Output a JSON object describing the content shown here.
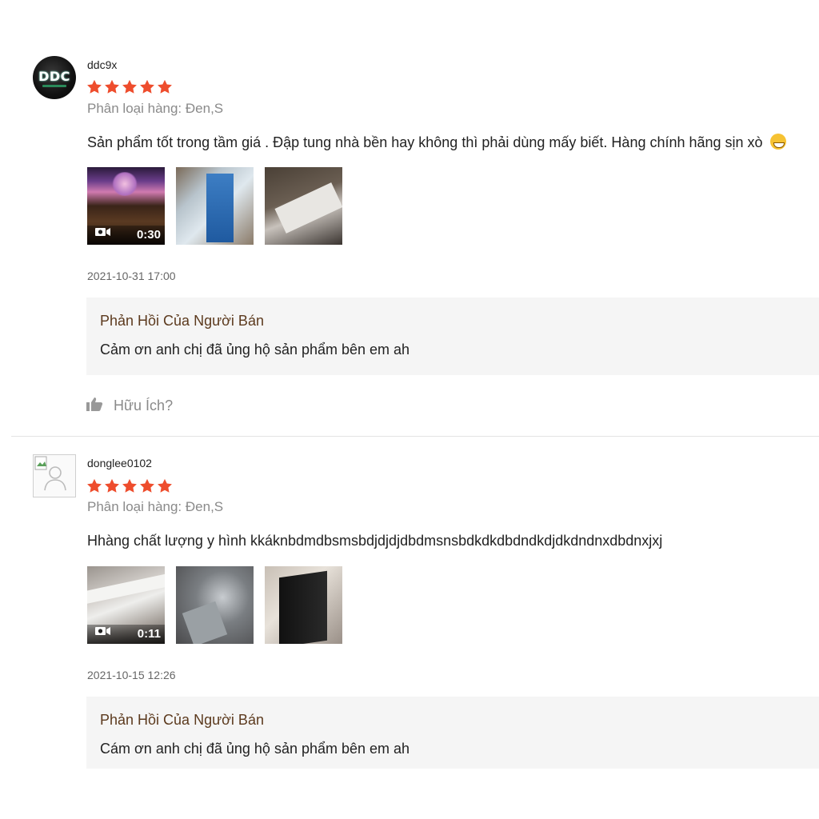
{
  "colors": {
    "star": "#ee4d2d",
    "reply_title": "#5c3a1e",
    "reply_bg": "#f5f5f5",
    "muted": "#8a8a8a"
  },
  "reviews": [
    {
      "username": "ddc9x",
      "avatar_text": "DDC",
      "rating": 5,
      "variation": "Phân loại hàng: Đen,S",
      "comment": "Sản phẩm tốt trong tầm giá . Đập tung nhà bền hay không thì phải dùng mấy biết. Hàng chính hãng sịn xò",
      "comment_emoji": "grinning-face-icon",
      "media": [
        {
          "type": "video",
          "duration": "0:30"
        },
        {
          "type": "image"
        },
        {
          "type": "image"
        }
      ],
      "date": "2021-10-31 17:00",
      "seller_reply": {
        "title": "Phản Hồi Của Người Bán",
        "text": "Cảm ơn anh chị đã ủng hộ sản phẩm bên em ah"
      },
      "helpful_label": "Hữu Ích?"
    },
    {
      "username": "donglee0102",
      "rating": 5,
      "variation": "Phân loại hàng: Đen,S",
      "comment": "Hhàng chất lượng  y hình  kkáknbdmdbsmsbdjdjdjdbdmsnsbdkdkdbdndkdjdkdndnxdbdnxjxj",
      "media": [
        {
          "type": "video",
          "duration": "0:11"
        },
        {
          "type": "image"
        },
        {
          "type": "image"
        }
      ],
      "date": "2021-10-15 12:26",
      "seller_reply": {
        "title": "Phản Hồi Của Người Bán",
        "text": "Cám ơn anh chị đã ủng hộ sản phẩm bên em ah"
      }
    }
  ]
}
